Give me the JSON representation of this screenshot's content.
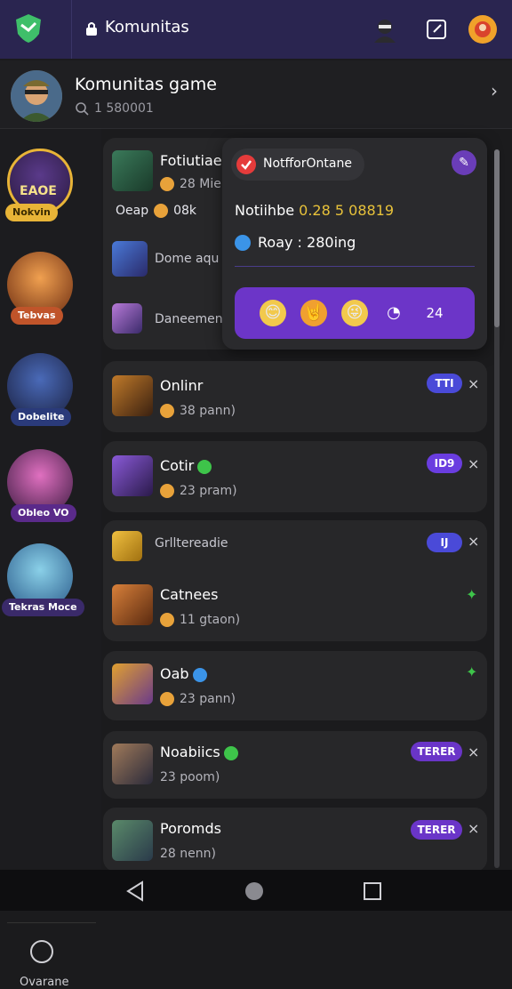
{
  "topbar": {
    "title": "Komunitas",
    "icons": [
      "shield-logo-icon",
      "lock-icon",
      "ninja-avatar-icon",
      "edit-icon",
      "profile-avatar-icon"
    ]
  },
  "header": {
    "title": "Komunitas game",
    "count": "1 580001",
    "icon": "search-icon"
  },
  "sidebar": {
    "items": [
      {
        "badge": "Nokvin"
      },
      {
        "badge": "Tebvas"
      },
      {
        "badge": "Dobelite"
      },
      {
        "badge": "Obleo VO"
      },
      {
        "badge": "Tekras Moce"
      }
    ],
    "bottom_label": "Ovarane"
  },
  "popup": {
    "pill_text": "NotfforOntane",
    "line1_label": "Notiihbe",
    "line1_value": "0.28 5 08819",
    "line2": "Roay : 280ing",
    "reactions": [
      "😊",
      "🤘",
      "😜",
      "◔",
      "24"
    ]
  },
  "card1": {
    "rows": [
      {
        "title": "Fotiutiae",
        "sub": "28 Mie"
      },
      {
        "title": "Oeap",
        "sub": "08k"
      },
      {
        "title": "Dome aqu",
        "sub": ""
      },
      {
        "title": "Daneemen",
        "sub": ""
      }
    ]
  },
  "rows": [
    {
      "title": "Onlinr",
      "sub": "38 pann)",
      "pill": "TTI"
    },
    {
      "title": "Cotir",
      "sub": "23 pram)",
      "pill": "ID9"
    },
    {
      "title": "Grlltereadie",
      "sub": "",
      "pill": "IJ"
    },
    {
      "title": "Catnees",
      "sub": "11 gtaon)",
      "pill": ""
    },
    {
      "title": "Oab",
      "sub": "23 pann)",
      "pill": ""
    },
    {
      "title": "Noabiics",
      "sub": "23 poom)",
      "pill": "TERER"
    },
    {
      "title": "Poromds",
      "sub": "28 nenn)",
      "pill": "TERER"
    }
  ],
  "colors": {
    "accent": "#6c35c8",
    "topbar": "#2a2550",
    "badge_gold": "#e8b437",
    "online_green": "#3ec44a"
  }
}
